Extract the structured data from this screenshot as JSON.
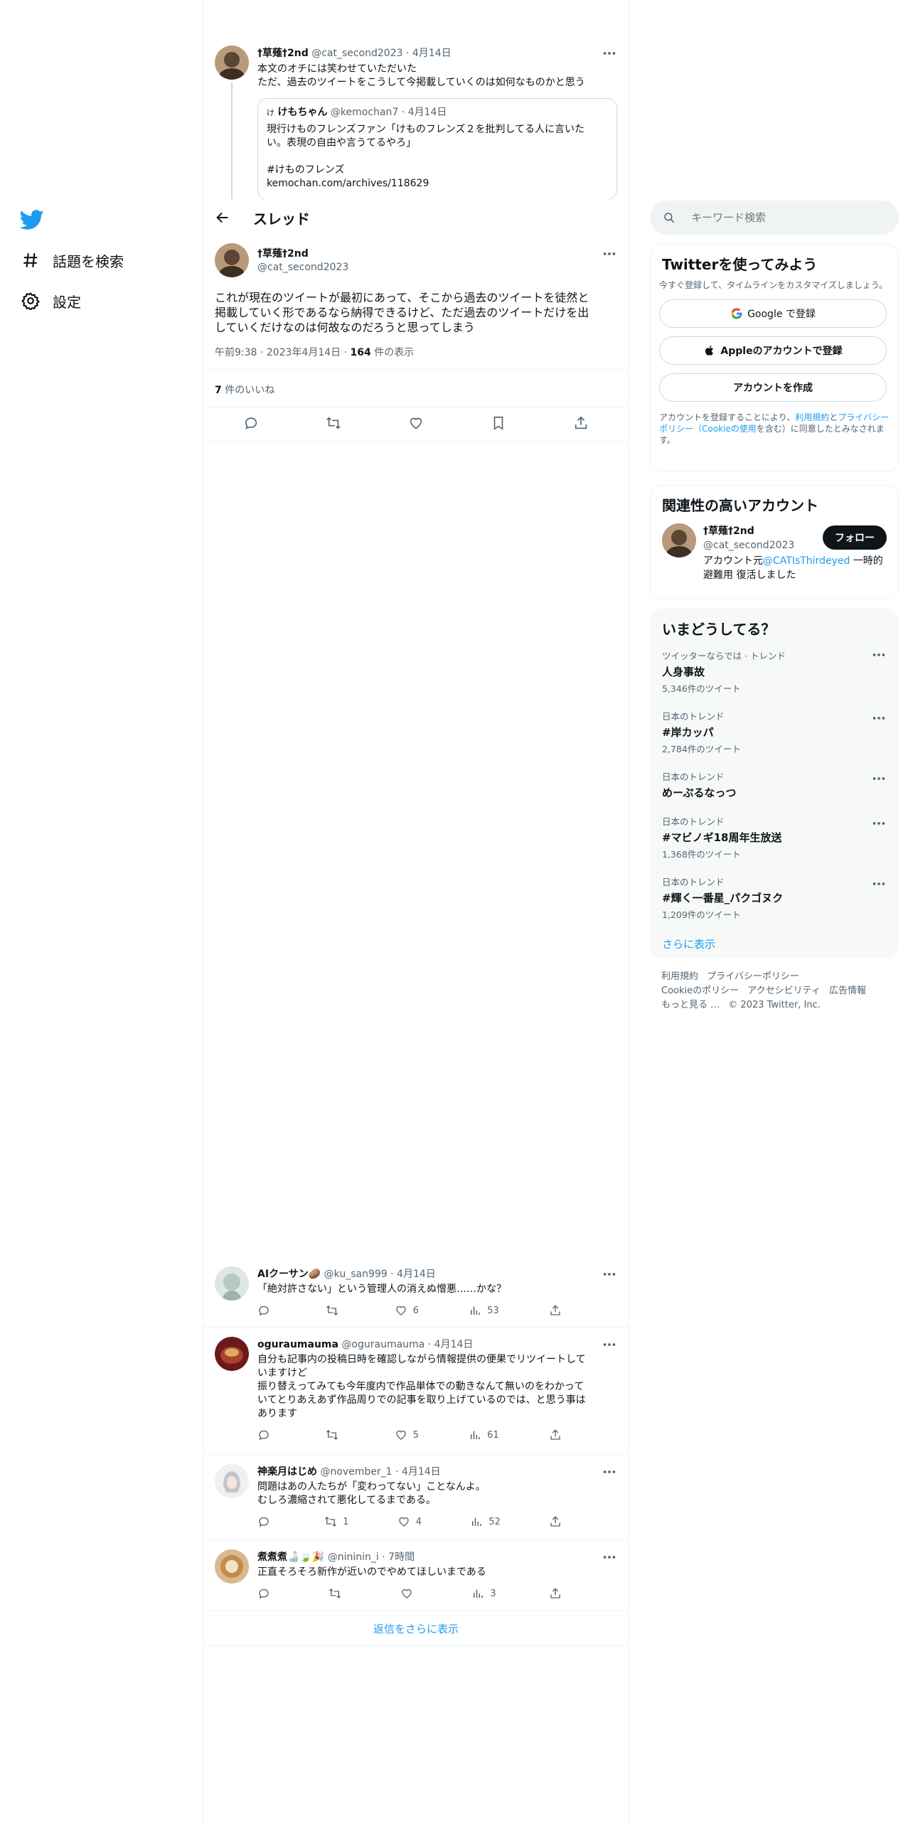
{
  "nav": {
    "explore_label": "話題を検索",
    "settings_label": "設定"
  },
  "top_tweet": {
    "name": "†草薙†2nd",
    "handle": "@cat_second2023",
    "date": "4月14日",
    "lines": [
      "本文のオチには笑わせていただいた",
      "ただ、過去のツイートをこうして今掲載していくのは如何なものかと思う"
    ],
    "quote": {
      "name": "けもちゃん",
      "handle": "@kemochan7",
      "date": "4月14日",
      "lines": [
        "現行けものフレンズファン「けものフレンズ２を批判してる人に言いた",
        "い。表現の自由や言うてるやろ」",
        "",
        "#けものフレンズ",
        "kemochan.com/archives/118629"
      ]
    }
  },
  "header": {
    "title": "スレッド"
  },
  "main_tweet": {
    "name": "†草薙†2nd",
    "handle": "@cat_second2023",
    "lines": [
      "これが現在のツイートが最初にあって、そこから過去のツイートを徒然と",
      "掲載していく形であるなら納得できるけど、ただ過去のツイートだけを出",
      "していくだけなのは何故なのだろうと思ってしまう"
    ],
    "time": "午前9:38",
    "date": "2023年4月14日",
    "views": "164",
    "views_label": "件の表示",
    "likes": "7",
    "likes_label": "件のいいね"
  },
  "replies": [
    {
      "name": "AIクーサン🥔",
      "handle": "@ku_san999",
      "date": "4月14日",
      "lines": [
        "「絶対許さない」という管理人の消えぬ憎悪……かな？"
      ],
      "retweets": "",
      "likes": "6",
      "views": "53"
    },
    {
      "name": "oguraumauma",
      "handle": "@oguraumauma",
      "date": "4月14日",
      "lines": [
        "自分も記事内の投稿日時を確認しながら情報提供の便果でリツイートして",
        "いますけど",
        "振り替えってみても今年度内で作品単体での動きなんて無いのをわかって",
        "いてとりあえあず作品周りでの記事を取り上げているのでは、と思う事は",
        "あります"
      ],
      "retweets": "",
      "likes": "5",
      "views": "61"
    },
    {
      "name": "神楽月はじめ",
      "handle": "@november_1",
      "date": "4月14日",
      "lines": [
        "問題はあの人たちが「変わってない」ことなんよ。",
        "むしろ濃縮されて悪化してるまである。"
      ],
      "retweets": "1",
      "likes": "4",
      "views": "52"
    },
    {
      "name": "煮煮煮🍶🍃🎉",
      "handle": "@nininin_i",
      "date": "7時間",
      "lines": [
        "正直そろそろ新作が近いのでやめてほしいまである"
      ],
      "retweets": "",
      "likes": "",
      "views": "3"
    }
  ],
  "show_more_replies": "返信をさらに表示",
  "search": {
    "placeholder": "キーワード検索"
  },
  "signup": {
    "title": "Twitterを使ってみよう",
    "desc": "今すぐ登録して、タイムラインをカスタマイズしましょう。",
    "google": "Google で登録",
    "apple": "Appleのアカウントで登録",
    "create": "アカウントを作成",
    "terms_1": "アカウントを登録することにより、",
    "terms_link_1": "利用規約",
    "terms_2": "と",
    "terms_link_2": "プライバシーポリシー（Cookieの使用",
    "terms_3": "を含む）に同意したとみなされます。"
  },
  "related": {
    "title": "関連性の高いアカウント",
    "name": "†草薙†2nd",
    "handle": "@cat_second2023",
    "follow": "フォロー",
    "bio_1": "アカウント元",
    "bio_link": "@CATIsThirdeyed",
    "bio_2": " 一時的避難用 復活しました"
  },
  "trends": {
    "title": "いまどうしてる？",
    "items": [
      {
        "category": "ツイッターならでは · トレンド",
        "title": "人身事故",
        "count": "5,346件のツイート"
      },
      {
        "category": "日本のトレンド",
        "title": "#岸カッパ",
        "count": "2,784件のツイート"
      },
      {
        "category": "日本のトレンド",
        "title": "めーぷるなっつ",
        "count": ""
      },
      {
        "category": "日本のトレンド",
        "title": "#マビノギ18周年生放送",
        "count": "1,368件のツイート"
      },
      {
        "category": "日本のトレンド",
        "title": "#輝く一番星_パクゴヌク",
        "count": "1,209件のツイート"
      }
    ],
    "show_more": "さらに表示"
  },
  "footer": {
    "terms": "利用規約",
    "privacy": "プライバシーポリシー",
    "cookie": "Cookieのポリシー",
    "accessibility": "アクセシビリティ",
    "ads": "広告情報",
    "more": "もっと見る …",
    "copyright": "© 2023 Twitter, Inc."
  },
  "colors": {
    "accent": "#1d9bf0",
    "text": "#0f1419",
    "secondary": "#536471"
  }
}
